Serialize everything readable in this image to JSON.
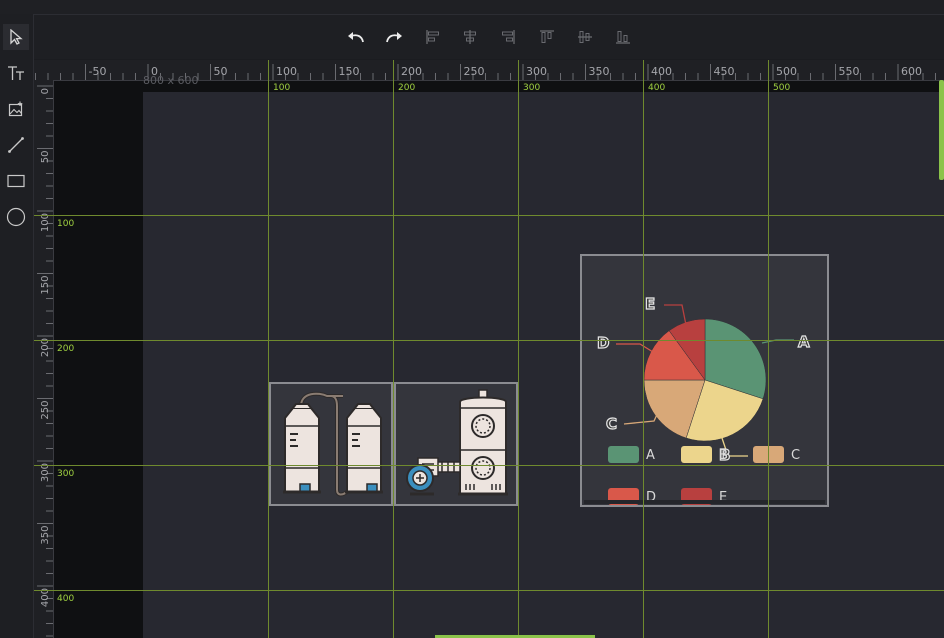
{
  "canvas": {
    "size_label": "800 x 600"
  },
  "tools": [
    {
      "name": "select-tool",
      "icon": "cursor-icon"
    },
    {
      "name": "text-tool",
      "icon": "text-icon"
    },
    {
      "name": "image-tool",
      "icon": "image-icon"
    },
    {
      "name": "line-tool",
      "icon": "line-icon"
    },
    {
      "name": "rect-tool",
      "icon": "rectangle-icon"
    },
    {
      "name": "circle-tool",
      "icon": "circle-icon"
    }
  ],
  "toolbar": [
    {
      "name": "undo-button",
      "icon": "undo-icon"
    },
    {
      "name": "redo-button",
      "icon": "redo-icon"
    },
    {
      "name": "align-left-button",
      "icon": "align-left-icon"
    },
    {
      "name": "align-center-h-button",
      "icon": "align-center-horizontal-icon"
    },
    {
      "name": "align-right-button",
      "icon": "align-right-icon"
    },
    {
      "name": "align-top-button",
      "icon": "align-top-icon"
    },
    {
      "name": "align-middle-v-button",
      "icon": "align-middle-vertical-icon"
    },
    {
      "name": "align-bottom-button",
      "icon": "align-bottom-icon"
    }
  ],
  "ruler_top": [
    "-50",
    "0",
    "50",
    "100",
    "150",
    "200",
    "250",
    "300",
    "350",
    "400",
    "450",
    "500",
    "550",
    "600"
  ],
  "ruler_left": [
    "0",
    "50",
    "100",
    "150",
    "200",
    "250",
    "300",
    "350",
    "400"
  ],
  "guides_vertical": [
    "100",
    "200",
    "300",
    "400",
    "500"
  ],
  "guides_horizontal": [
    "100",
    "200",
    "300",
    "400"
  ],
  "chart_data": {
    "type": "pie",
    "categories": [
      "A",
      "B",
      "C",
      "D",
      "E"
    ],
    "values": [
      30,
      25,
      20,
      15,
      10
    ],
    "colors": [
      "#5a9474",
      "#ecd58c",
      "#d8a878",
      "#d9584a",
      "#b8403f"
    ],
    "legend_position": "bottom"
  },
  "colors": {
    "guide": "#6f8a2e",
    "guide_label": "#9fd040",
    "accent": "#8bc34a"
  }
}
